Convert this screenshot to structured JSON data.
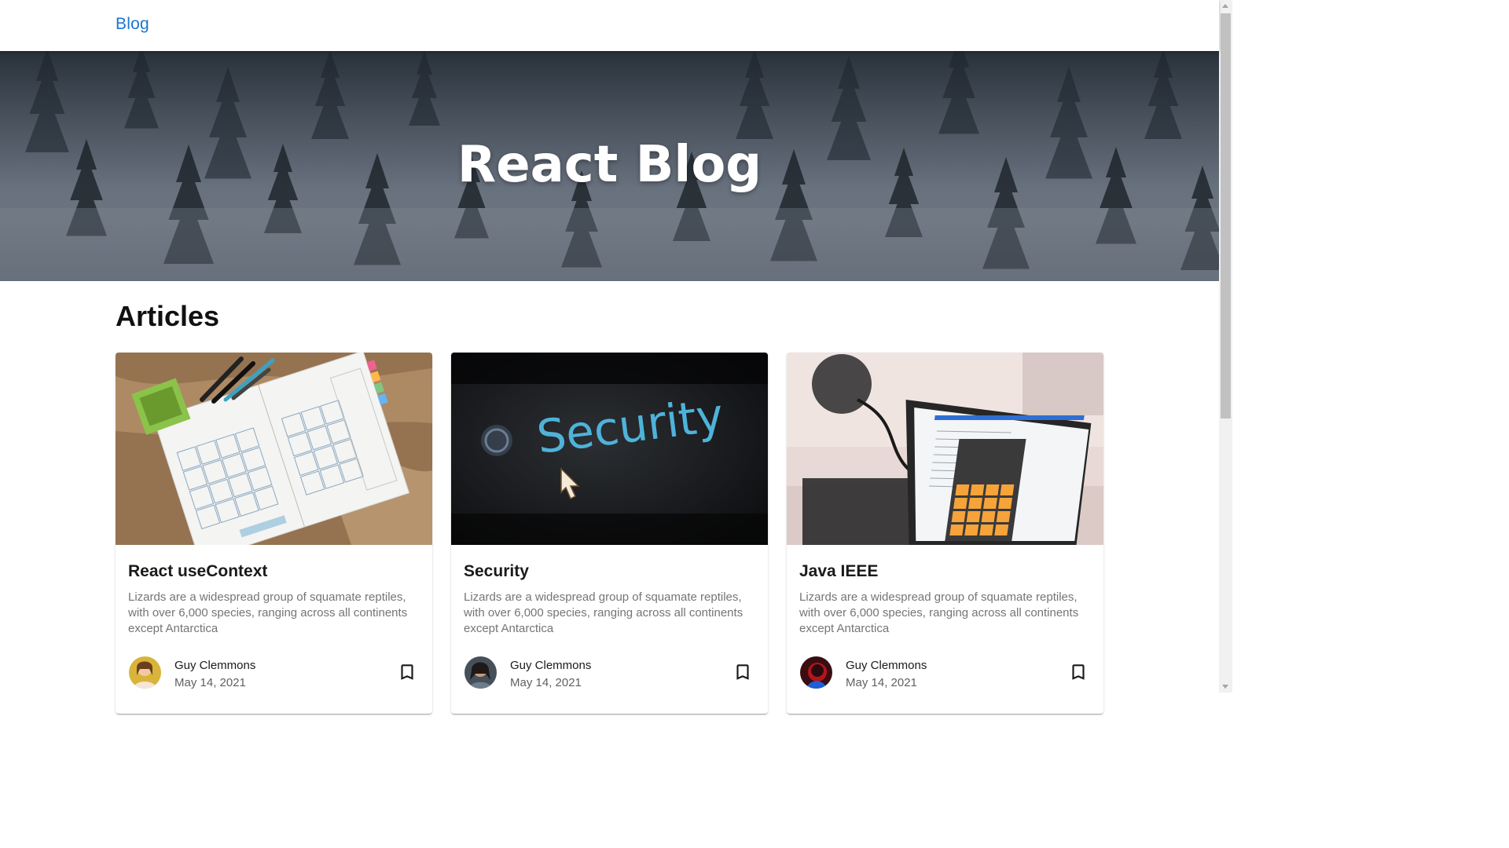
{
  "header": {
    "brand": "Blog"
  },
  "hero": {
    "title": "React Blog"
  },
  "section": {
    "title": "Articles"
  },
  "cards": [
    {
      "image_name": "calendar-journal-image",
      "title": "React useContext",
      "text": "Lizards are a widespread group of squamate reptiles, with over 6,000 species, ranging across all continents except Antarctica",
      "author": "Guy Clemmons",
      "date": "May 14, 2021"
    },
    {
      "image_name": "security-screen-image",
      "title": "Security",
      "image_text": "Security",
      "text": "Lizards are a widespread group of squamate reptiles, with over 6,000 species, ranging across all continents except Antarctica",
      "author": "Guy Clemmons",
      "date": "May 14, 2021"
    },
    {
      "image_name": "laptop-calculator-image",
      "title": "Java IEEE",
      "text": "Lizards are a widespread group of squamate reptiles, with over 6,000 species, ranging across all continents except Antarctica",
      "author": "Guy Clemmons",
      "date": "May 14, 2021"
    }
  ],
  "colors": {
    "brand": "#1976d2",
    "calc_orange": "#f6a33a"
  },
  "icons": {
    "bookmark": "bookmark-border-icon"
  }
}
